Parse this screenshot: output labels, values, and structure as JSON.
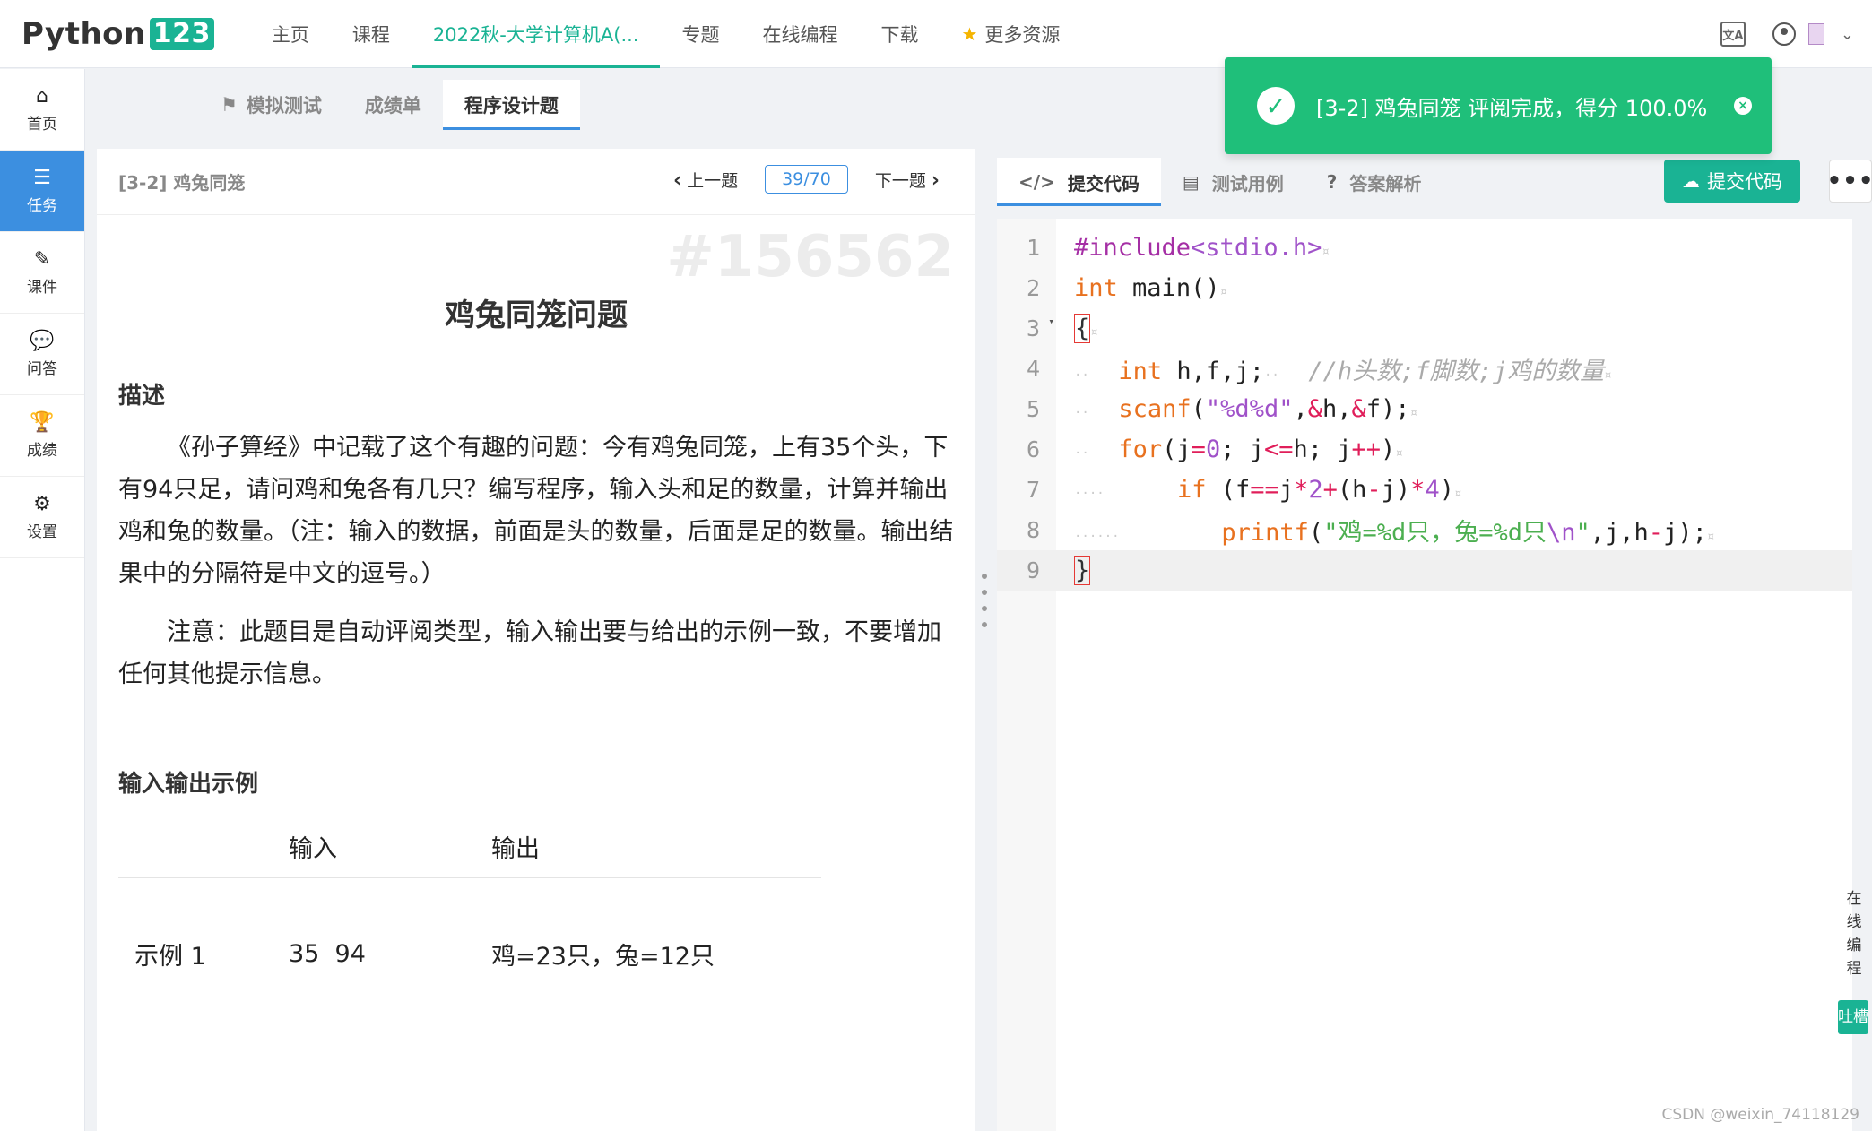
{
  "logo": {
    "text": "Python",
    "num": "123"
  },
  "nav": [
    {
      "label": "主页"
    },
    {
      "label": "课程"
    },
    {
      "label": "2022秋-大学计算机A(..."
    },
    {
      "label": "专题"
    },
    {
      "label": "在线编程"
    },
    {
      "label": "下载"
    },
    {
      "label": "更多资源"
    }
  ],
  "sidebar": [
    {
      "label": "首页",
      "icon": "⌂"
    },
    {
      "label": "任务",
      "icon": "☰"
    },
    {
      "label": "课件",
      "icon": "✎"
    },
    {
      "label": "问答",
      "icon": "💬"
    },
    {
      "label": "成绩",
      "icon": "🏆"
    },
    {
      "label": "设置",
      "icon": "⚙"
    }
  ],
  "subtabs": [
    {
      "label": "模拟测试"
    },
    {
      "label": "成绩单"
    },
    {
      "label": "程序设计题"
    }
  ],
  "problem": {
    "code": "[3-2] 鸡兔同笼",
    "prev": "上一题",
    "page": "39/70",
    "next": "下一题",
    "watermark": "#156562",
    "title": "鸡兔同笼问题",
    "desc_title": "描述",
    "desc1": "《孙子算经》中记载了这个有趣的问题：今有鸡兔同笼，上有35个头，下有94只足，请问鸡和兔各有几只？编写程序，输入头和足的数量，计算并输出鸡和兔的数量。（注：输入的数据，前面是头的数量，后面是足的数量。输出结果中的分隔符是中文的逗号。）",
    "desc2": "注意：此题目是自动评阅类型，输入输出要与给出的示例一致，不要增加任何其他提示信息。",
    "example_title": "输入输出示例",
    "col_input": "输入",
    "col_output": "输出",
    "ex_label": "示例 1",
    "ex_input": "35  94",
    "ex_output": "鸡=23只，兔=12只"
  },
  "editor_tabs": [
    {
      "label": "提交代码",
      "icon": "</>"
    },
    {
      "label": "测试用例",
      "icon": "▤"
    },
    {
      "label": "答案解析",
      "icon": "?"
    }
  ],
  "submit_label": "提交代码",
  "more_label": "•••",
  "code_lines": [
    "1",
    "2",
    "3",
    "4",
    "5",
    "6",
    "7",
    "8",
    "9"
  ],
  "toast": {
    "message": "[3-2] 鸡兔同笼 评阅完成，得分 100.0%"
  },
  "float_tab": "在线编程",
  "float_btn": "吐槽",
  "watermark_csdn": "CSDN @weixin_74118129"
}
